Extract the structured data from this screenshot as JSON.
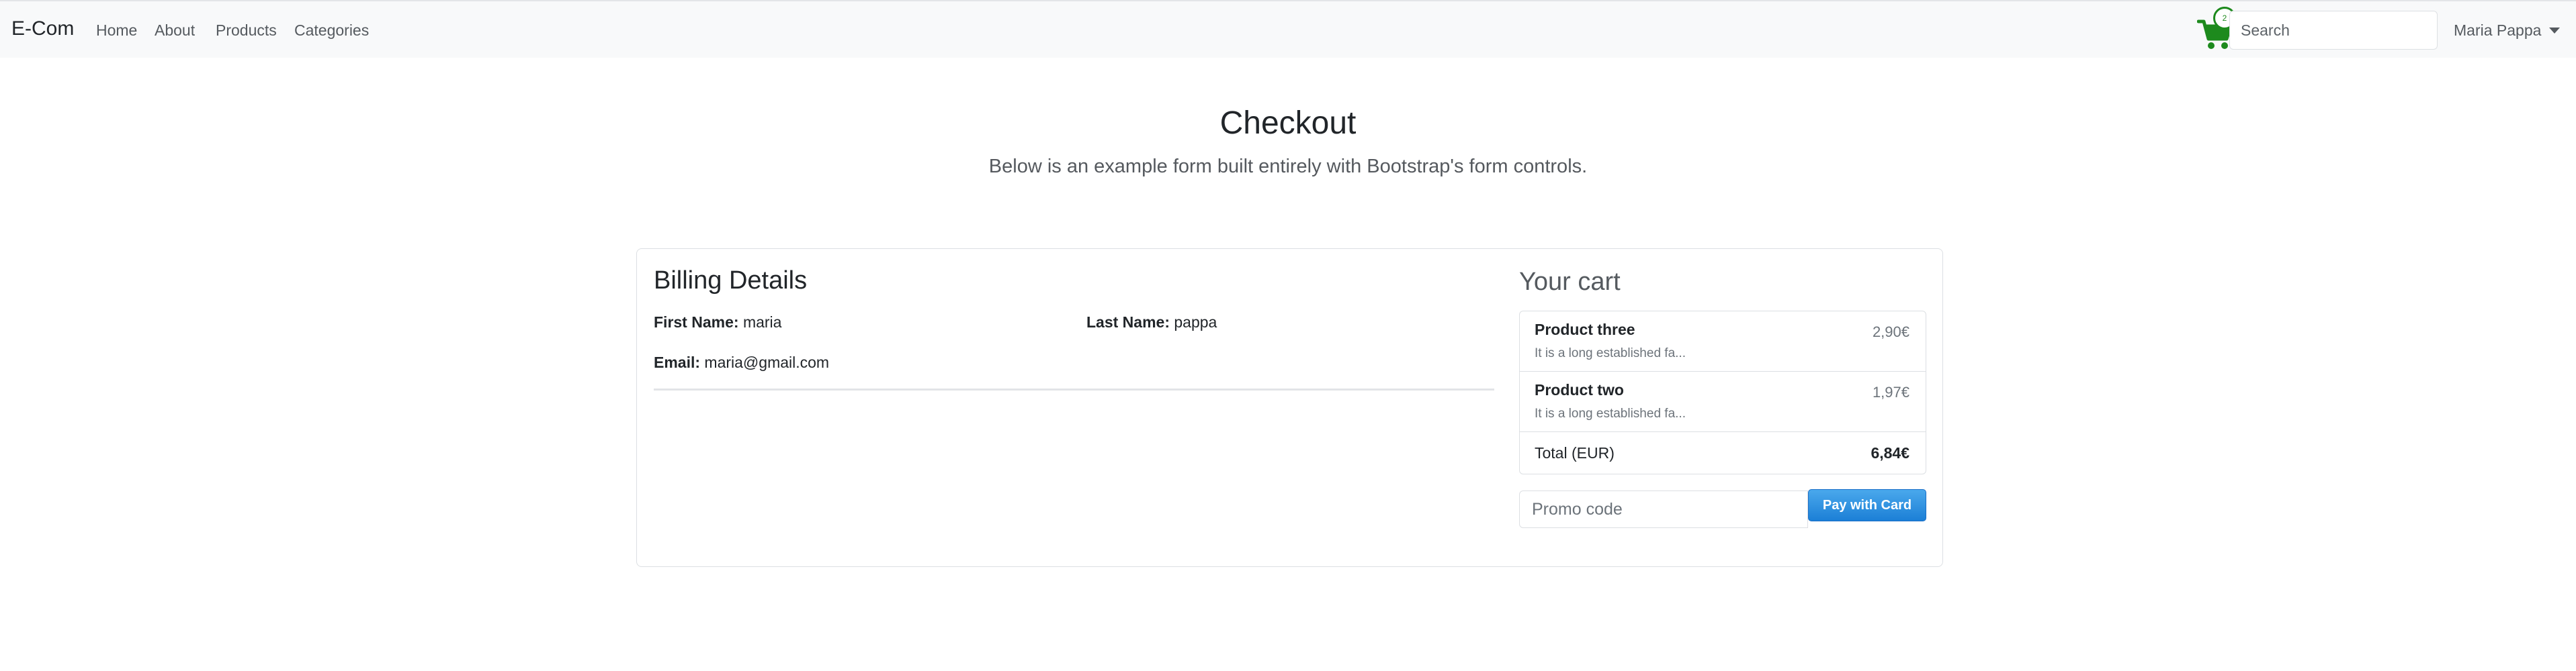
{
  "navbar": {
    "brand": "E-Com",
    "links": [
      "Home",
      "About",
      "Products",
      "Categories"
    ],
    "cart_count": "2",
    "cart_icon": "shopping-cart-icon",
    "cart_color": "#1d8a1d",
    "search_placeholder": "Search",
    "user_name": "Maria Pappa"
  },
  "header": {
    "title": "Checkout",
    "lead": "Below is an example form built entirely with Bootstrap's form controls."
  },
  "billing": {
    "title": "Billing Details",
    "first_name_label": "First Name:",
    "first_name": "maria",
    "last_name_label": "Last Name:",
    "last_name": "pappa",
    "email_label": "Email:",
    "email": "maria@gmail.com"
  },
  "cart": {
    "title": "Your cart",
    "items": [
      {
        "name": "Product three",
        "desc": "It is a long established fa...",
        "price": "2,90€"
      },
      {
        "name": "Product two",
        "desc": "It is a long established fa...",
        "price": "1,97€"
      }
    ],
    "total_label": "Total (EUR)",
    "total_value": "6,84€",
    "promo_placeholder": "Promo code",
    "pay_label": "Pay with Card",
    "pay_color": "#1c7fd6"
  }
}
